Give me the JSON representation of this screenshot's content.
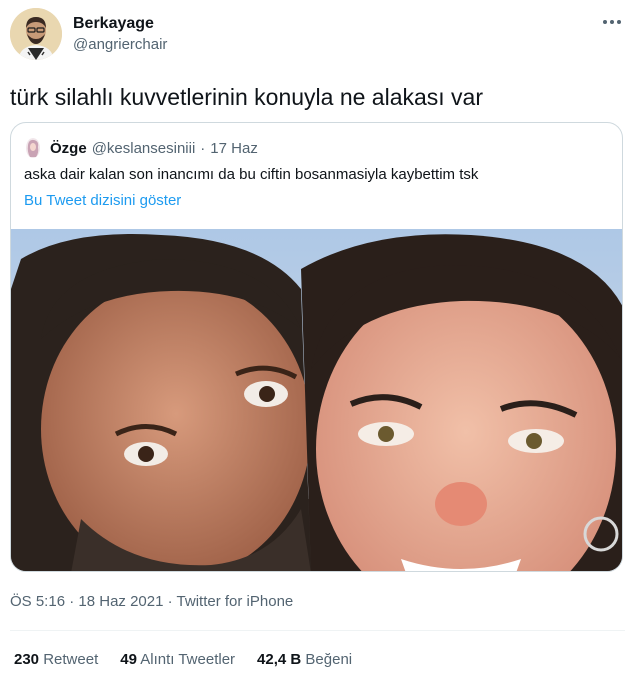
{
  "author": {
    "display_name": "Berkayage",
    "handle": "@angrierchair",
    "avatar_icon": "person-avatar-icon"
  },
  "tweet": {
    "text": "türk silahlı kuvvetlerinin konuyla ne alakası var",
    "time": "ÖS 5:16",
    "date": "18 Haz 2021",
    "separator": "·",
    "source": "Twitter for iPhone"
  },
  "quoted": {
    "display_name": "Özge",
    "handle": "@keslansesiniii",
    "separator": "·",
    "date": "17 Haz",
    "text": "aska dair kalan son inancımı da bu ciftin bosanmasiyla kaybettim tsk",
    "show_thread_label": "Bu Tweet dizisini göster"
  },
  "stats": {
    "retweets_count": "230",
    "retweets_label": "Retweet",
    "quotes_count": "49",
    "quotes_label": "Alıntı Tweetler",
    "likes_count": "42,4 B",
    "likes_label": "Beğeni"
  },
  "colors": {
    "link": "#1d9bf0",
    "secondary_text": "#536471",
    "border": "#cfd9de"
  }
}
